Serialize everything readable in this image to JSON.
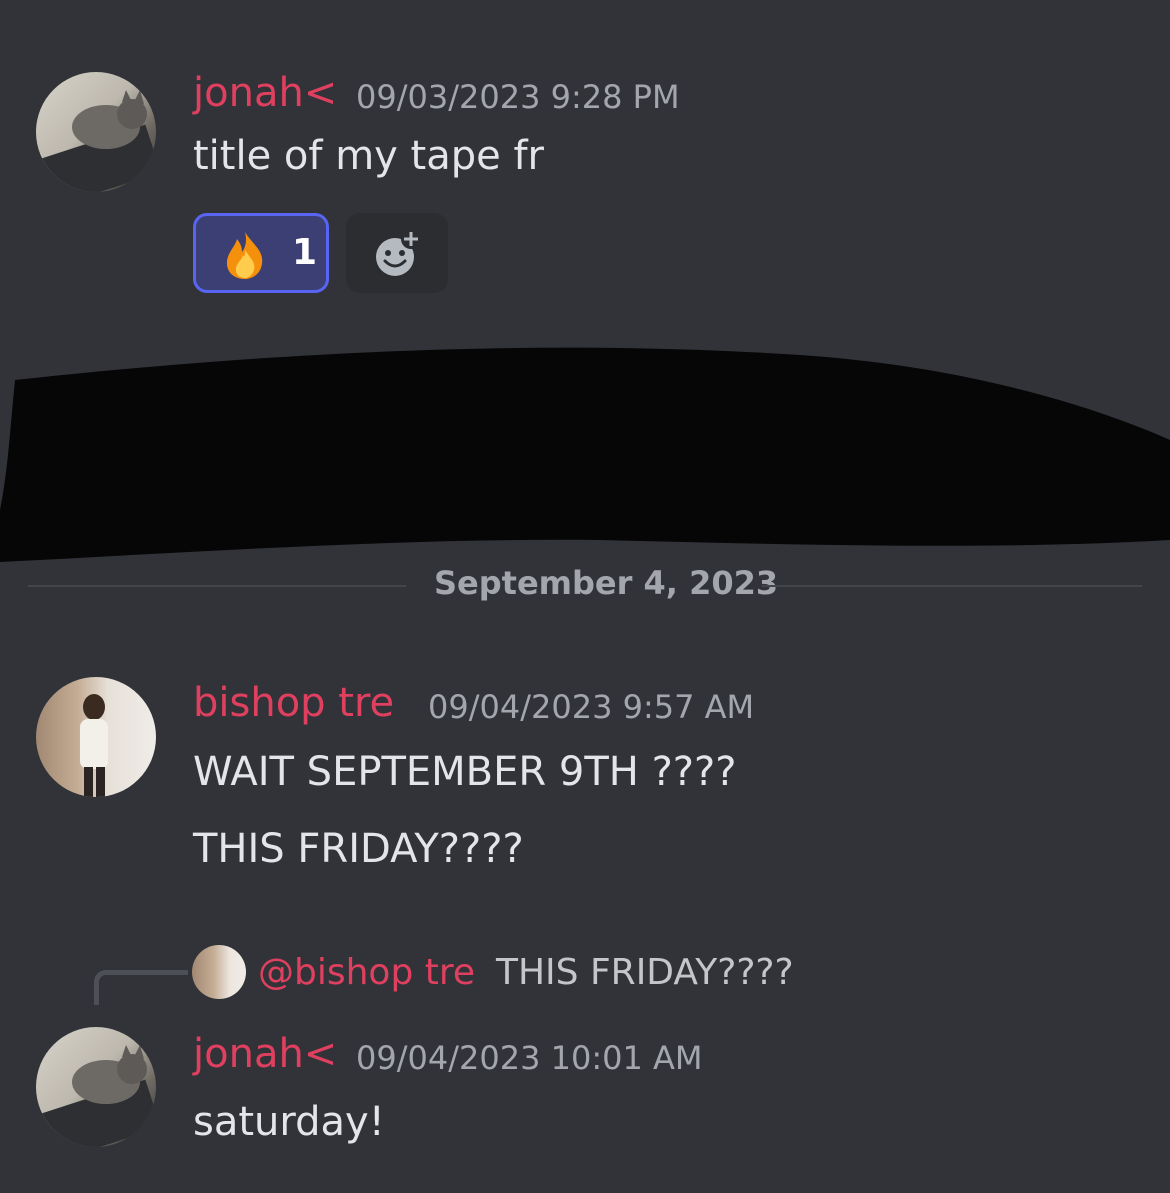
{
  "messages": [
    {
      "author": "jonah<",
      "timestamp": "09/03/2023 9:28 PM",
      "lines": [
        "title of my tape fr"
      ],
      "avatar_icon": "cat-on-skateboard-avatar",
      "reaction": {
        "emoji": "fire-icon",
        "count": "1"
      }
    },
    {
      "author": "bishop tre",
      "timestamp": "09/04/2023 9:57 AM",
      "lines": [
        "WAIT SEPTEMBER 9TH ????",
        "THIS FRIDAY????"
      ],
      "avatar_icon": "person-avatar"
    },
    {
      "author": "jonah<",
      "timestamp": "09/04/2023 10:01 AM",
      "lines": [
        "saturday!"
      ],
      "avatar_icon": "cat-on-skateboard-avatar",
      "reply": {
        "mention": "@bishop tre",
        "text": "THIS FRIDAY????"
      }
    }
  ],
  "date_divider": "September 4, 2023",
  "colors": {
    "background": "#313338",
    "author": "#e0405f",
    "reaction_border": "#5865f2"
  }
}
